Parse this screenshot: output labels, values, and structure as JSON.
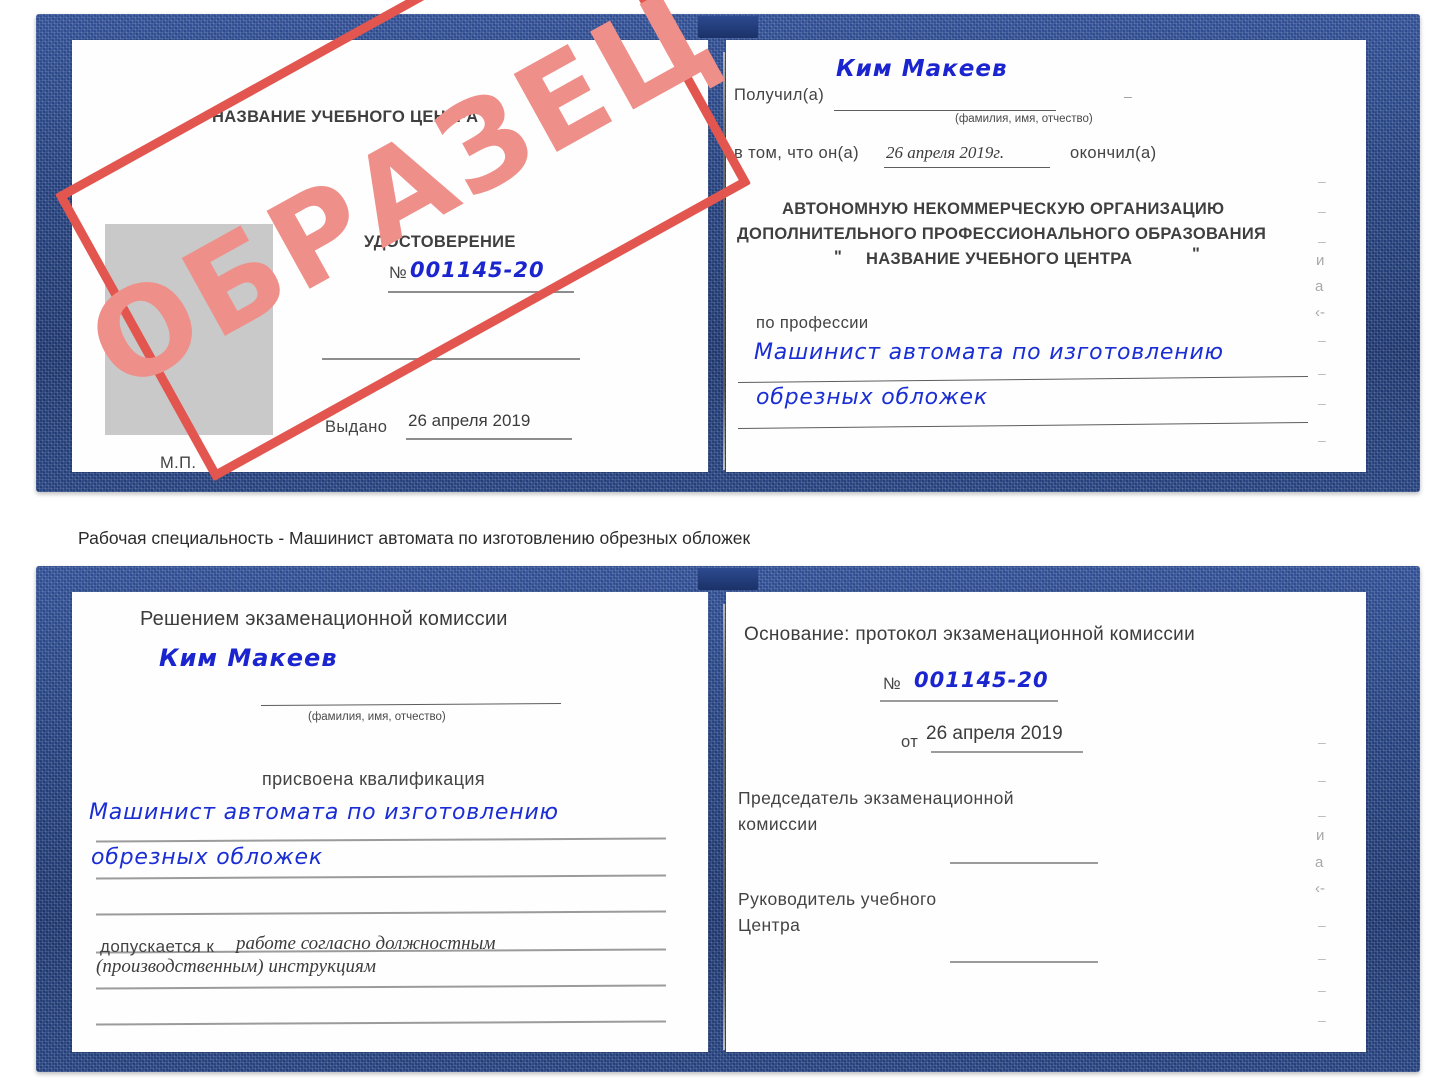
{
  "document_type": "russian-training-certificate-sample",
  "watermark": {
    "text": "ОБРАЗЕЦ",
    "color": "#ef8f89",
    "border_color": "#e2564f"
  },
  "caption": "Рабочая специальность - Машинист автомата по изготовлению обрезных обложек",
  "cover": {
    "color": "#23407f"
  },
  "certificate_top": {
    "left_page": {
      "center_name": "НАЗВАНИЕ УЧЕБНОГО ЦЕНТРА",
      "title": "УДОСТОВЕРЕНИЕ",
      "number_label": "№",
      "number_value": "001145-20",
      "issued_label": "Выдано",
      "issued_value": "26 апреля 2019",
      "seal_label": "М.П."
    },
    "right_page": {
      "received_label": "Получил(а)",
      "received_value": "Ким Макеев",
      "fio_hint": "(фамилия, имя, отчество)",
      "that_he_label": "в том, что он(а)",
      "completion_date": "26 апреля 2019г.",
      "finished_label": "окончил(а)",
      "org_line1": "АВТОНОМНУЮ НЕКОММЕРЧЕСКУЮ ОРГАНИЗАЦИЮ",
      "org_line2": "ДОПОЛНИТЕЛЬНОГО ПРОФЕССИОНАЛЬНОГО ОБРАЗОВАНИЯ",
      "org_quote_open": "\"",
      "org_line3": "НАЗВАНИЕ УЧЕБНОГО ЦЕНТРА",
      "org_quote_close": "\"",
      "profession_label": "по профессии",
      "profession_line1": "Машинист автомата по изготовлению",
      "profession_line2": "обрезных обложек",
      "margin_bleed": [
        "–",
        "–",
        "–",
        "и",
        "а",
        "‹-",
        "–",
        "–",
        "–",
        "–"
      ]
    }
  },
  "certificate_bottom": {
    "left_page": {
      "heading": "Решением экзаменационной комиссии",
      "name_value": "Ким Макеев",
      "fio_hint": "(фамилия, имя, отчество)",
      "qualification_label": "присвоена квалификация",
      "qualification_line1": "Машинист автомата по изготовлению",
      "qualification_line2": "обрезных обложек",
      "allowed_label": "допускается к",
      "allowed_value_line1": "работе согласно должностным",
      "allowed_value_line2": "(производственным) инструкциям"
    },
    "right_page": {
      "basis_label": "Основание: протокол экзаменационной комиссии",
      "number_label": "№",
      "number_value": "001145-20",
      "date_label": "от",
      "date_value": "26 апреля 2019",
      "chairman_line1": "Председатель экзаменационной",
      "chairman_line2": "комиссии",
      "head_line1": "Руководитель учебного",
      "head_line2": "Центра",
      "margin_bleed": [
        "–",
        "–",
        "–",
        "и",
        "а",
        "‹-",
        "–",
        "–",
        "–",
        "–"
      ]
    }
  }
}
